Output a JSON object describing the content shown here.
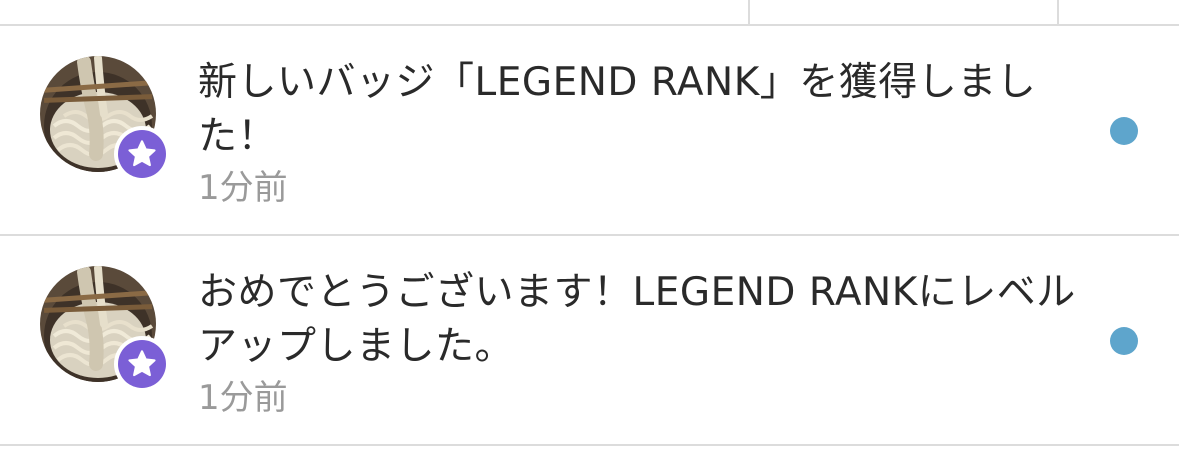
{
  "notifications": [
    {
      "message": "新しいバッジ「LEGEND RANK」を獲得しました！",
      "time": "1分前",
      "unread": true,
      "avatar_icon": "udon-noodles-photo",
      "badge_icon": "star-icon"
    },
    {
      "message": "おめでとうございます！LEGEND RANKにレベルアップしました。",
      "time": "1分前",
      "unread": true,
      "avatar_icon": "udon-noodles-photo",
      "badge_icon": "star-icon"
    }
  ],
  "colors": {
    "badge": "#7b5fd6",
    "unread_dot": "#5ea5cc",
    "time_text": "#9a9a9a",
    "divider": "#dcdcdc"
  }
}
